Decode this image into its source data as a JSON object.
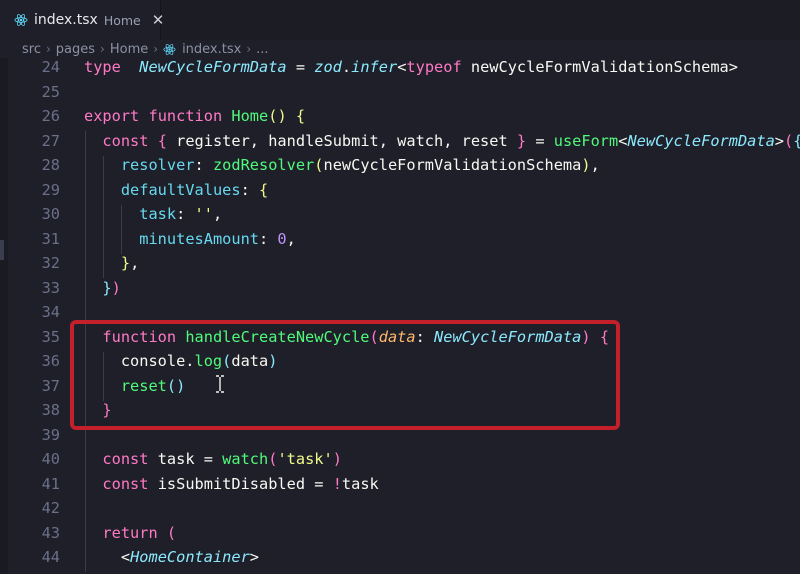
{
  "tab": {
    "filename": "index.tsx",
    "subtitle": "Home",
    "close": "✕"
  },
  "breadcrumb": {
    "parts": [
      "src",
      "pages",
      "Home",
      "index.tsx",
      "..."
    ]
  },
  "lines": [
    {
      "n": "24",
      "tokens": [
        [
          "kw",
          "type"
        ],
        [
          "",
          "  "
        ],
        [
          "ty",
          "NewCycleFormData"
        ],
        [
          "",
          " = "
        ],
        [
          "ty",
          "zod"
        ],
        [
          "",
          "."
        ],
        [
          "ty",
          "infer"
        ],
        [
          "",
          "<"
        ],
        [
          "kw",
          "typeof"
        ],
        [
          "",
          " newCycleFormValidationSchema>"
        ]
      ]
    },
    {
      "n": "25",
      "tokens": []
    },
    {
      "n": "26",
      "tokens": [
        [
          "kw",
          "export"
        ],
        [
          "",
          " "
        ],
        [
          "kw",
          "function"
        ],
        [
          "",
          " "
        ],
        [
          "fn",
          "Home"
        ],
        [
          "br1",
          "()"
        ],
        [
          "",
          " "
        ],
        [
          "br1",
          "{"
        ]
      ]
    },
    {
      "n": "27",
      "tokens": [
        [
          "",
          "  "
        ],
        [
          "kw",
          "const"
        ],
        [
          "",
          " "
        ],
        [
          "br2",
          "{"
        ],
        [
          "",
          " register, handleSubmit, watch, reset "
        ],
        [
          "br2",
          "}"
        ],
        [
          "",
          " = "
        ],
        [
          "fn",
          "useForm"
        ],
        [
          "",
          "<"
        ],
        [
          "ty",
          "NewCycleFormData"
        ],
        [
          "",
          ">"
        ],
        [
          "br2",
          "("
        ],
        [
          "br3",
          "{"
        ]
      ]
    },
    {
      "n": "28",
      "tokens": [
        [
          "",
          "    "
        ],
        [
          "pr",
          "resolver"
        ],
        [
          "",
          ": "
        ],
        [
          "fn",
          "zodResolver"
        ],
        [
          "br1",
          "("
        ],
        [
          "",
          "newCycleFormValidationSchema"
        ],
        [
          "br1",
          ")"
        ],
        [
          "",
          ","
        ]
      ]
    },
    {
      "n": "29",
      "tokens": [
        [
          "",
          "    "
        ],
        [
          "pr",
          "defaultValues"
        ],
        [
          "",
          ": "
        ],
        [
          "br1",
          "{"
        ]
      ]
    },
    {
      "n": "30",
      "tokens": [
        [
          "",
          "      "
        ],
        [
          "pr",
          "task"
        ],
        [
          "",
          ": "
        ],
        [
          "st",
          "''"
        ],
        [
          "",
          ","
        ]
      ]
    },
    {
      "n": "31",
      "tokens": [
        [
          "",
          "      "
        ],
        [
          "pr",
          "minutesAmount"
        ],
        [
          "",
          ": "
        ],
        [
          "nu",
          "0"
        ],
        [
          "",
          ","
        ]
      ]
    },
    {
      "n": "32",
      "tokens": [
        [
          "",
          "    "
        ],
        [
          "br1",
          "}"
        ],
        [
          "",
          ","
        ]
      ]
    },
    {
      "n": "33",
      "tokens": [
        [
          "",
          "  "
        ],
        [
          "br3",
          "}"
        ],
        [
          "br2",
          ")"
        ]
      ]
    },
    {
      "n": "34",
      "tokens": []
    },
    {
      "n": "35",
      "tokens": [
        [
          "",
          "  "
        ],
        [
          "kw",
          "function"
        ],
        [
          "",
          " "
        ],
        [
          "fn",
          "handleCreateNewCycle"
        ],
        [
          "br2",
          "("
        ],
        [
          "pa",
          "data"
        ],
        [
          "",
          ": "
        ],
        [
          "ty",
          "NewCycleFormData"
        ],
        [
          "br2",
          ")"
        ],
        [
          "",
          " "
        ],
        [
          "br2",
          "{"
        ]
      ]
    },
    {
      "n": "36",
      "tokens": [
        [
          "",
          "    console."
        ],
        [
          "fn",
          "log"
        ],
        [
          "br3",
          "("
        ],
        [
          "",
          "data"
        ],
        [
          "br3",
          ")"
        ]
      ]
    },
    {
      "n": "37",
      "tokens": [
        [
          "",
          "    "
        ],
        [
          "fn",
          "reset"
        ],
        [
          "br3",
          "()"
        ]
      ]
    },
    {
      "n": "38",
      "tokens": [
        [
          "",
          "  "
        ],
        [
          "br2",
          "}"
        ]
      ]
    },
    {
      "n": "39",
      "tokens": []
    },
    {
      "n": "40",
      "tokens": [
        [
          "",
          "  "
        ],
        [
          "kw",
          "const"
        ],
        [
          "",
          " task = "
        ],
        [
          "fn",
          "watch"
        ],
        [
          "br2",
          "("
        ],
        [
          "st",
          "'task'"
        ],
        [
          "br2",
          ")"
        ]
      ]
    },
    {
      "n": "41",
      "tokens": [
        [
          "",
          "  "
        ],
        [
          "kw",
          "const"
        ],
        [
          "",
          " isSubmitDisabled = "
        ],
        [
          "kw",
          "!"
        ],
        [
          "",
          "task"
        ]
      ]
    },
    {
      "n": "42",
      "tokens": []
    },
    {
      "n": "43",
      "tokens": [
        [
          "",
          "  "
        ],
        [
          "kw",
          "return"
        ],
        [
          "",
          " "
        ],
        [
          "br2",
          "("
        ]
      ]
    },
    {
      "n": "44",
      "tokens": [
        [
          "",
          "    <"
        ],
        [
          "ty",
          "HomeContainer"
        ],
        [
          "",
          ">"
        ]
      ]
    }
  ],
  "colors": {
    "background": "#1e1f29",
    "highlight_box": "#c3202c",
    "react_icon": "#61dafb"
  }
}
